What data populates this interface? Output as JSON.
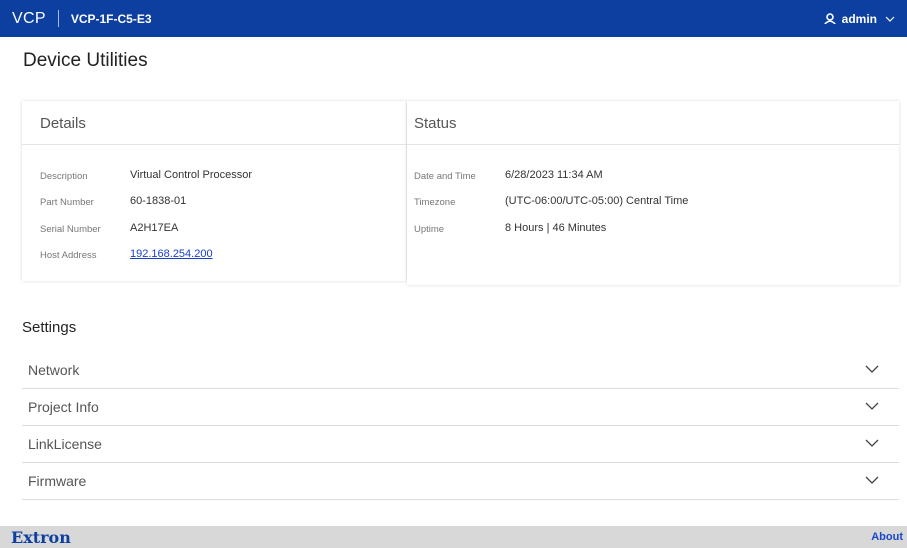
{
  "header": {
    "brand": "VCP",
    "device_name": "VCP-1F-C5-E3",
    "user": "admin"
  },
  "page": {
    "title": "Device Utilities"
  },
  "details": {
    "heading": "Details",
    "rows": [
      {
        "label": "Description",
        "value": "Virtual Control Processor"
      },
      {
        "label": "Part Number",
        "value": "60-1838-01"
      },
      {
        "label": "Serial Number",
        "value": "A2H17EA"
      },
      {
        "label": "Host Address",
        "value": "192.168.254.200"
      }
    ]
  },
  "status": {
    "heading": "Status",
    "rows": [
      {
        "label": "Date and Time",
        "value": "6/28/2023 11:34 AM"
      },
      {
        "label": "Timezone",
        "value": "(UTC-06:00/UTC-05:00) Central Time"
      },
      {
        "label": "Uptime",
        "value": "8 Hours | 46 Minutes"
      }
    ]
  },
  "settings": {
    "heading": "Settings",
    "sections": [
      {
        "label": "Network"
      },
      {
        "label": "Project Info"
      },
      {
        "label": "LinkLicense"
      },
      {
        "label": "Firmware"
      }
    ]
  },
  "footer": {
    "logo": "Extron",
    "about": "About"
  },
  "colors": {
    "header_bg": "#0d3fa0",
    "footer_bg": "#d8d8d8",
    "link": "#1a3fcc"
  }
}
